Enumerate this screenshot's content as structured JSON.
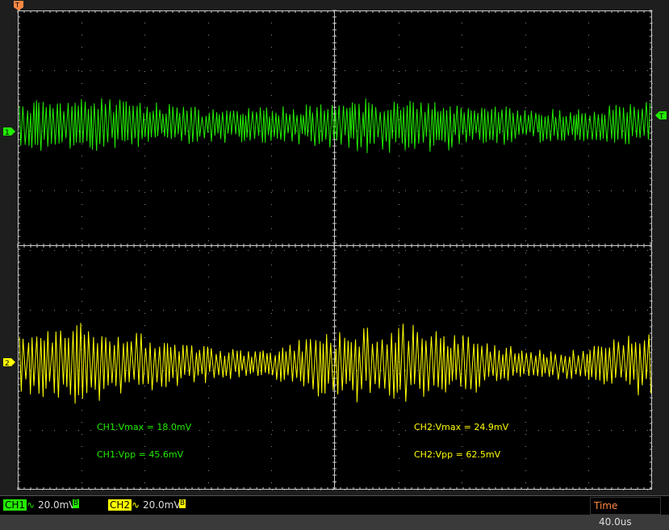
{
  "ch1_marker": "1",
  "ch2_marker": "2",
  "trigger_marker": "T",
  "ch1": {
    "label": "CH1",
    "coupling_icon": "ac-coupling-icon",
    "volts_div": "20.0mV",
    "bw": "B",
    "color": "#22ee00",
    "vmax": "CH1:Vmax = 18.0mV",
    "vpp": "CH1:Vpp = 45.6mV",
    "peak_to_peak_mv": 45.6,
    "max_mv": 18.0
  },
  "ch2": {
    "label": "CH2",
    "coupling_icon": "ac-coupling-icon",
    "volts_div": "20.0mV",
    "bw": "B",
    "color": "#ffff00",
    "vmax": "CH2:Vmax = 24.9mV",
    "vpp": "CH2:Vpp = 62.5mV",
    "peak_to_peak_mv": 62.5,
    "max_mv": 24.9
  },
  "time": {
    "label": "Time",
    "value": "40.0us"
  },
  "colors": {
    "grid_bg": "#000000",
    "grid": "#cccccc",
    "time_label": "#ff8844"
  }
}
